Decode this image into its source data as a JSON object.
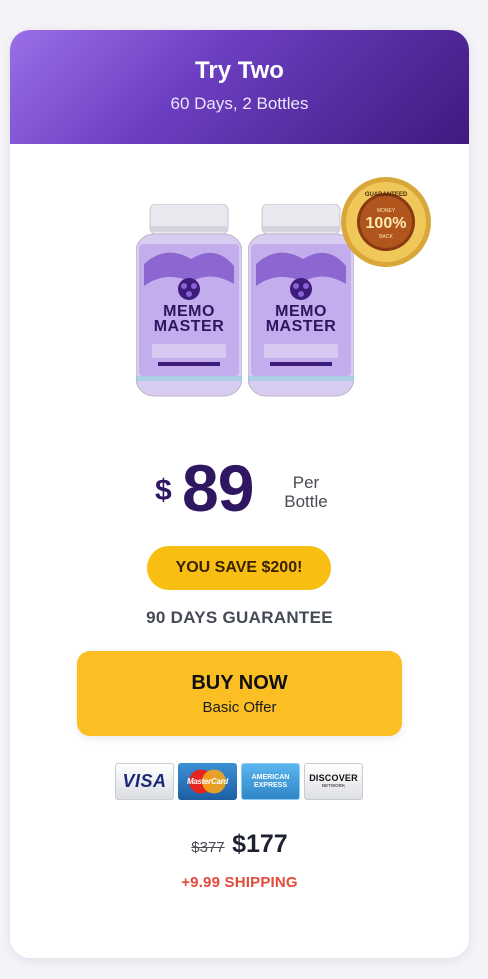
{
  "offer": {
    "title": "Try Two",
    "subtitle": "60 Days, 2 Bottles"
  },
  "product": {
    "label_line1": "MEMO",
    "label_line2": "MASTER",
    "badge_top": "GUARANTEED",
    "badge_percent": "100%",
    "badge_money": "MONEY",
    "badge_back": "BACK"
  },
  "pricing": {
    "currency": "$",
    "price": "89",
    "per_line1": "Per",
    "per_line2": "Bottle",
    "savings": "YOU SAVE $200!",
    "guarantee": "90 DAYS GUARANTEE"
  },
  "buy_button": {
    "label": "BUY NOW",
    "sublabel": "Basic Offer"
  },
  "payment_methods": {
    "visa": "VISA",
    "mastercard": "MasterCard",
    "amex_line1": "AMERICAN",
    "amex_line2": "EXPRESS",
    "discover": "DISCOVER",
    "discover_sub": "NETWORK"
  },
  "totals": {
    "old_price": "$377",
    "new_price": "$177",
    "shipping": "+9.99 SHIPPING"
  },
  "colors": {
    "header_start": "#9a6fe8",
    "header_end": "#3f1a7e",
    "accent_yellow": "#fbbf24",
    "price_purple": "#2e1660",
    "shipping_red": "#e24a3b"
  }
}
